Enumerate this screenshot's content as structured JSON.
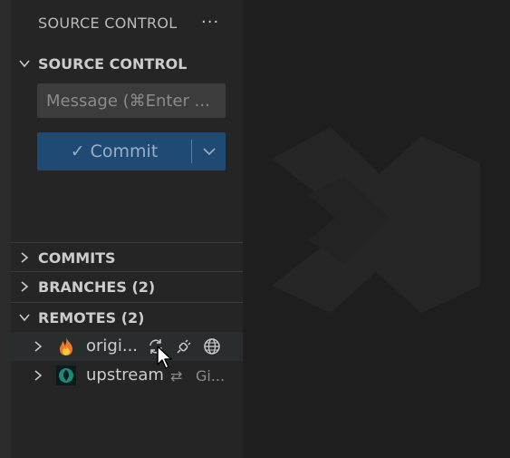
{
  "viewlet": {
    "title": "SOURCE CONTROL",
    "more_icon": "more-icon",
    "more_glyph": "···"
  },
  "scm_section": {
    "header": "SOURCE CONTROL",
    "message_placeholder": "Message (⌘Enter ...",
    "commit_label": "Commit",
    "commit_check": "✓"
  },
  "sections": {
    "commits": "COMMITS",
    "branches": "BRANCHES (2)",
    "remotes": "REMOTES (2)"
  },
  "remotes": [
    {
      "name": "origi...",
      "icon": "fire-icon",
      "actions": [
        "sync-icon",
        "plug-icon",
        "globe-icon"
      ]
    },
    {
      "name": "upstream",
      "icon": "gitea-icon",
      "meta_icon": "arrows-icon",
      "meta_glyph": "⇄",
      "meta_text": "Gi..."
    }
  ],
  "colors": {
    "sidebar_bg": "#252526",
    "input_bg": "#3c3c3c",
    "button_bg": "#1f4a73",
    "hover_bg": "#2a2d2e"
  }
}
